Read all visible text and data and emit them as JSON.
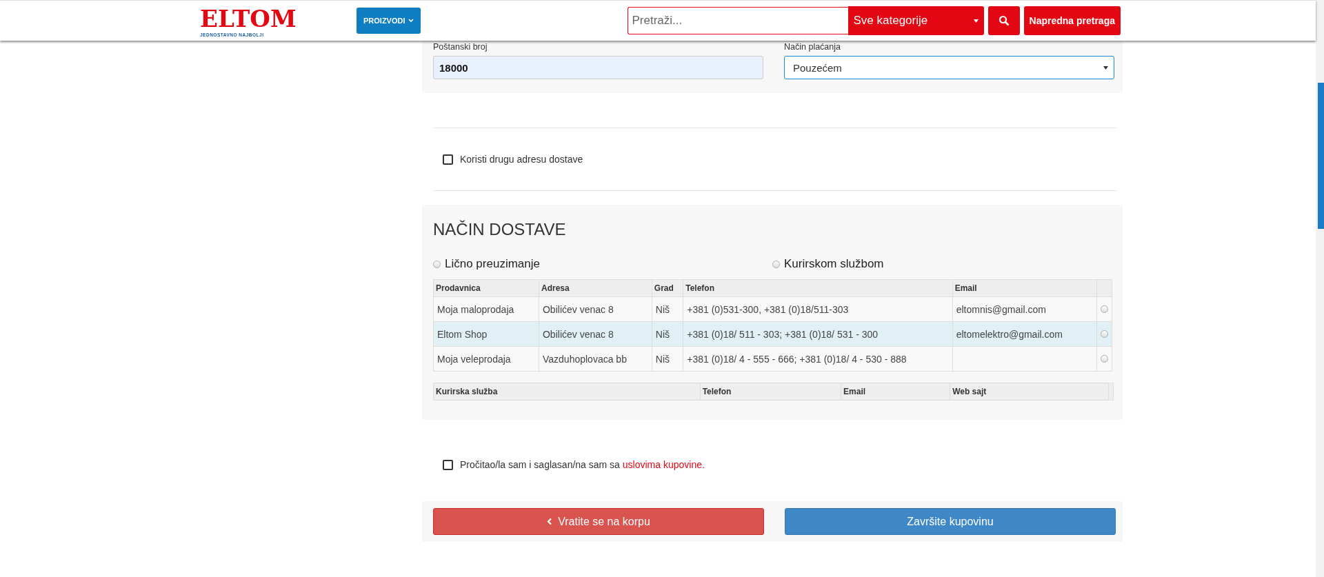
{
  "header": {
    "logo": {
      "name": "ELTOM",
      "tagline": "JEDNOSTAVNO NAJBOLJI"
    },
    "products_button": "PROIZVODI",
    "search": {
      "placeholder": "Pretraži..."
    },
    "category_select": "Sve kategorije",
    "advanced_search": "Napredna pretraga"
  },
  "order_form": {
    "postal_code": {
      "label": "Poštanski broj",
      "value": "18000"
    },
    "payment": {
      "label": "Način plaćanja",
      "value": "Pouzećem"
    }
  },
  "alt_address": {
    "label": "Koristi drugu adresu dostave",
    "checked": false
  },
  "delivery": {
    "title": "NAČIN DOSTAVE",
    "options": [
      {
        "label": "Lično preuzimanje",
        "selected": false
      },
      {
        "label": "Kurirskom službom",
        "selected": false
      }
    ],
    "stores": {
      "columns": [
        "Prodavnica",
        "Adresa",
        "Grad",
        "Telefon",
        "Email"
      ],
      "rows": [
        {
          "store": "Moja maloprodaja",
          "address": "Obilićev venac 8",
          "city": "Niš",
          "phone": "+381 (0)531-300, +381 (0)18/511-303",
          "email": "eltomnis@gmail.com",
          "highlighted": false,
          "selected": false
        },
        {
          "store": "Eltom Shop",
          "address": "Obilićev venac 8",
          "city": "Niš",
          "phone": "+381 (0)18/ 511 - 303; +381 (0)18/ 531 - 300",
          "email": "eltomelektro@gmail.com",
          "highlighted": true,
          "selected": false
        },
        {
          "store": "Moja veleprodaja",
          "address": "Vazduhoplovaca bb",
          "city": "Niš",
          "phone": "+381 (0)18/ 4 - 555 - 666; +381 (0)18/ 4 - 530 - 888",
          "highlighted": false,
          "selected": false
        }
      ]
    },
    "couriers": {
      "columns": [
        "Kurirska služba",
        "Telefon",
        "Email",
        "Web sajt"
      ]
    }
  },
  "terms": {
    "text": "Pročitao/la sam i saglasan/na sam sa",
    "link": "uslovima kupovine.",
    "checked": false
  },
  "buttons": [
    {
      "label": "Vratite se na korpu",
      "kind": "back"
    },
    {
      "label": "Završite kupovinu",
      "kind": "primary"
    }
  ]
}
